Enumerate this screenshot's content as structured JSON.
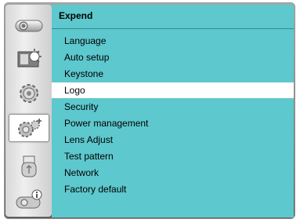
{
  "panel": {
    "title": "Expend"
  },
  "menu": {
    "items": [
      {
        "label": "Language"
      },
      {
        "label": "Auto setup"
      },
      {
        "label": "Keystone"
      },
      {
        "label": "Logo",
        "selected": true
      },
      {
        "label": "Security"
      },
      {
        "label": "Power management"
      },
      {
        "label": "Lens Adjust"
      },
      {
        "label": "Test pattern"
      },
      {
        "label": "Network"
      },
      {
        "label": "Factory default"
      }
    ]
  },
  "sidebar": {
    "items": [
      {
        "icon": "projector-icon"
      },
      {
        "icon": "image-adjust-icon"
      },
      {
        "icon": "gear-icon"
      },
      {
        "icon": "gear-plus-icon",
        "selected": true
      },
      {
        "icon": "usb-icon"
      },
      {
        "icon": "projector-info-icon"
      }
    ]
  },
  "colors": {
    "panel_bg": "#5dc8cd",
    "selected_bg": "#ffffff",
    "frame_gray": "#8a8a8a"
  }
}
